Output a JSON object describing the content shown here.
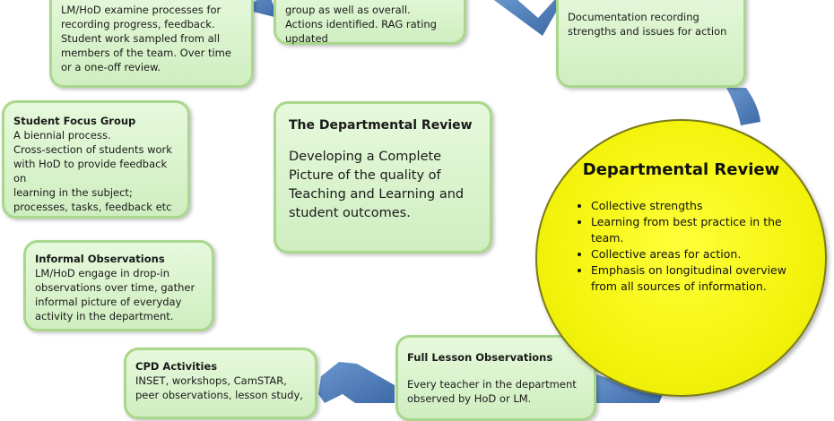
{
  "boxes": {
    "review_left": {
      "title": "",
      "body": "LM/HoD examine processes for\nrecording progress, feedback.\nStudent work sampled from all\nmembers of the team.  Over time\nor a one-off review."
    },
    "review_mid": {
      "body": "group as well as overall.\nActions identified. RAG rating\nupdated"
    },
    "review_right": {
      "body": "Documentation recording\nstrengths and issues for action"
    },
    "focus": {
      "title": "Student Focus Group",
      "body": "A biennial process.\nCross-section of students work\nwith HoD to provide feedback on\nlearning in the subject;\nprocesses, tasks, feedback etc"
    },
    "informal": {
      "title": "Informal Observations",
      "body": "LM/HoD engage in drop-in\nobservations over time, gather\ninformal picture of everyday\nactivity in the department."
    },
    "cpd": {
      "title": "CPD Activities",
      "body": "INSET, workshops, CamSTAR,\npeer observations, lesson study,"
    },
    "full": {
      "title": "Full Lesson Observations",
      "body": "Every teacher in the department\nobserved by HoD or LM."
    }
  },
  "center": {
    "title": "The Departmental Review",
    "body": "Developing a Complete\nPicture of the quality of\nTeaching and Learning and\nstudent outcomes."
  },
  "circle": {
    "title": "Departmental Review",
    "items": [
      "Collective strengths",
      "Learning from best practice in the team.",
      "Collective areas for action.",
      "Emphasis on longitudinal overview from all sources of information."
    ]
  },
  "colors": {
    "box_fill": "#d8f3ca",
    "box_border": "#a9d88d",
    "arrow": "#4f81bd",
    "circle_fill": "#f3f30c"
  }
}
